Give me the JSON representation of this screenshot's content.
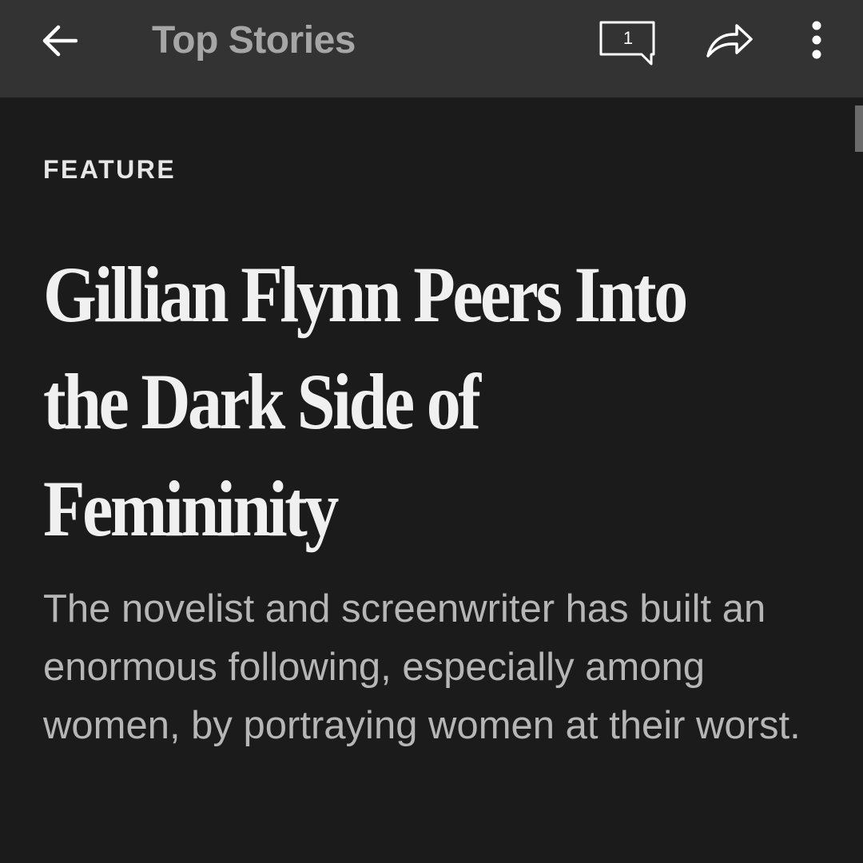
{
  "app_bar": {
    "title": "Top Stories",
    "comments_count": "1",
    "icons": {
      "back": "arrow-left-icon",
      "comments": "comment-bubble-icon",
      "share": "share-icon",
      "more": "vertical-dots-icon"
    }
  },
  "article": {
    "kicker": "FEATURE",
    "headline_lines": [
      "Gillian Flynn Peers Into",
      "the Dark Side of",
      "Femininity"
    ],
    "summary": "The novelist and screenwriter has built an enormous following, especially among women, by portraying women at their worst."
  },
  "colors": {
    "app_bar_background": "#333333",
    "page_background": "#1b1b1b",
    "title_text": "#a6a6a6",
    "headline_text": "#f0f0f0",
    "summary_text": "#b6b6b6"
  }
}
